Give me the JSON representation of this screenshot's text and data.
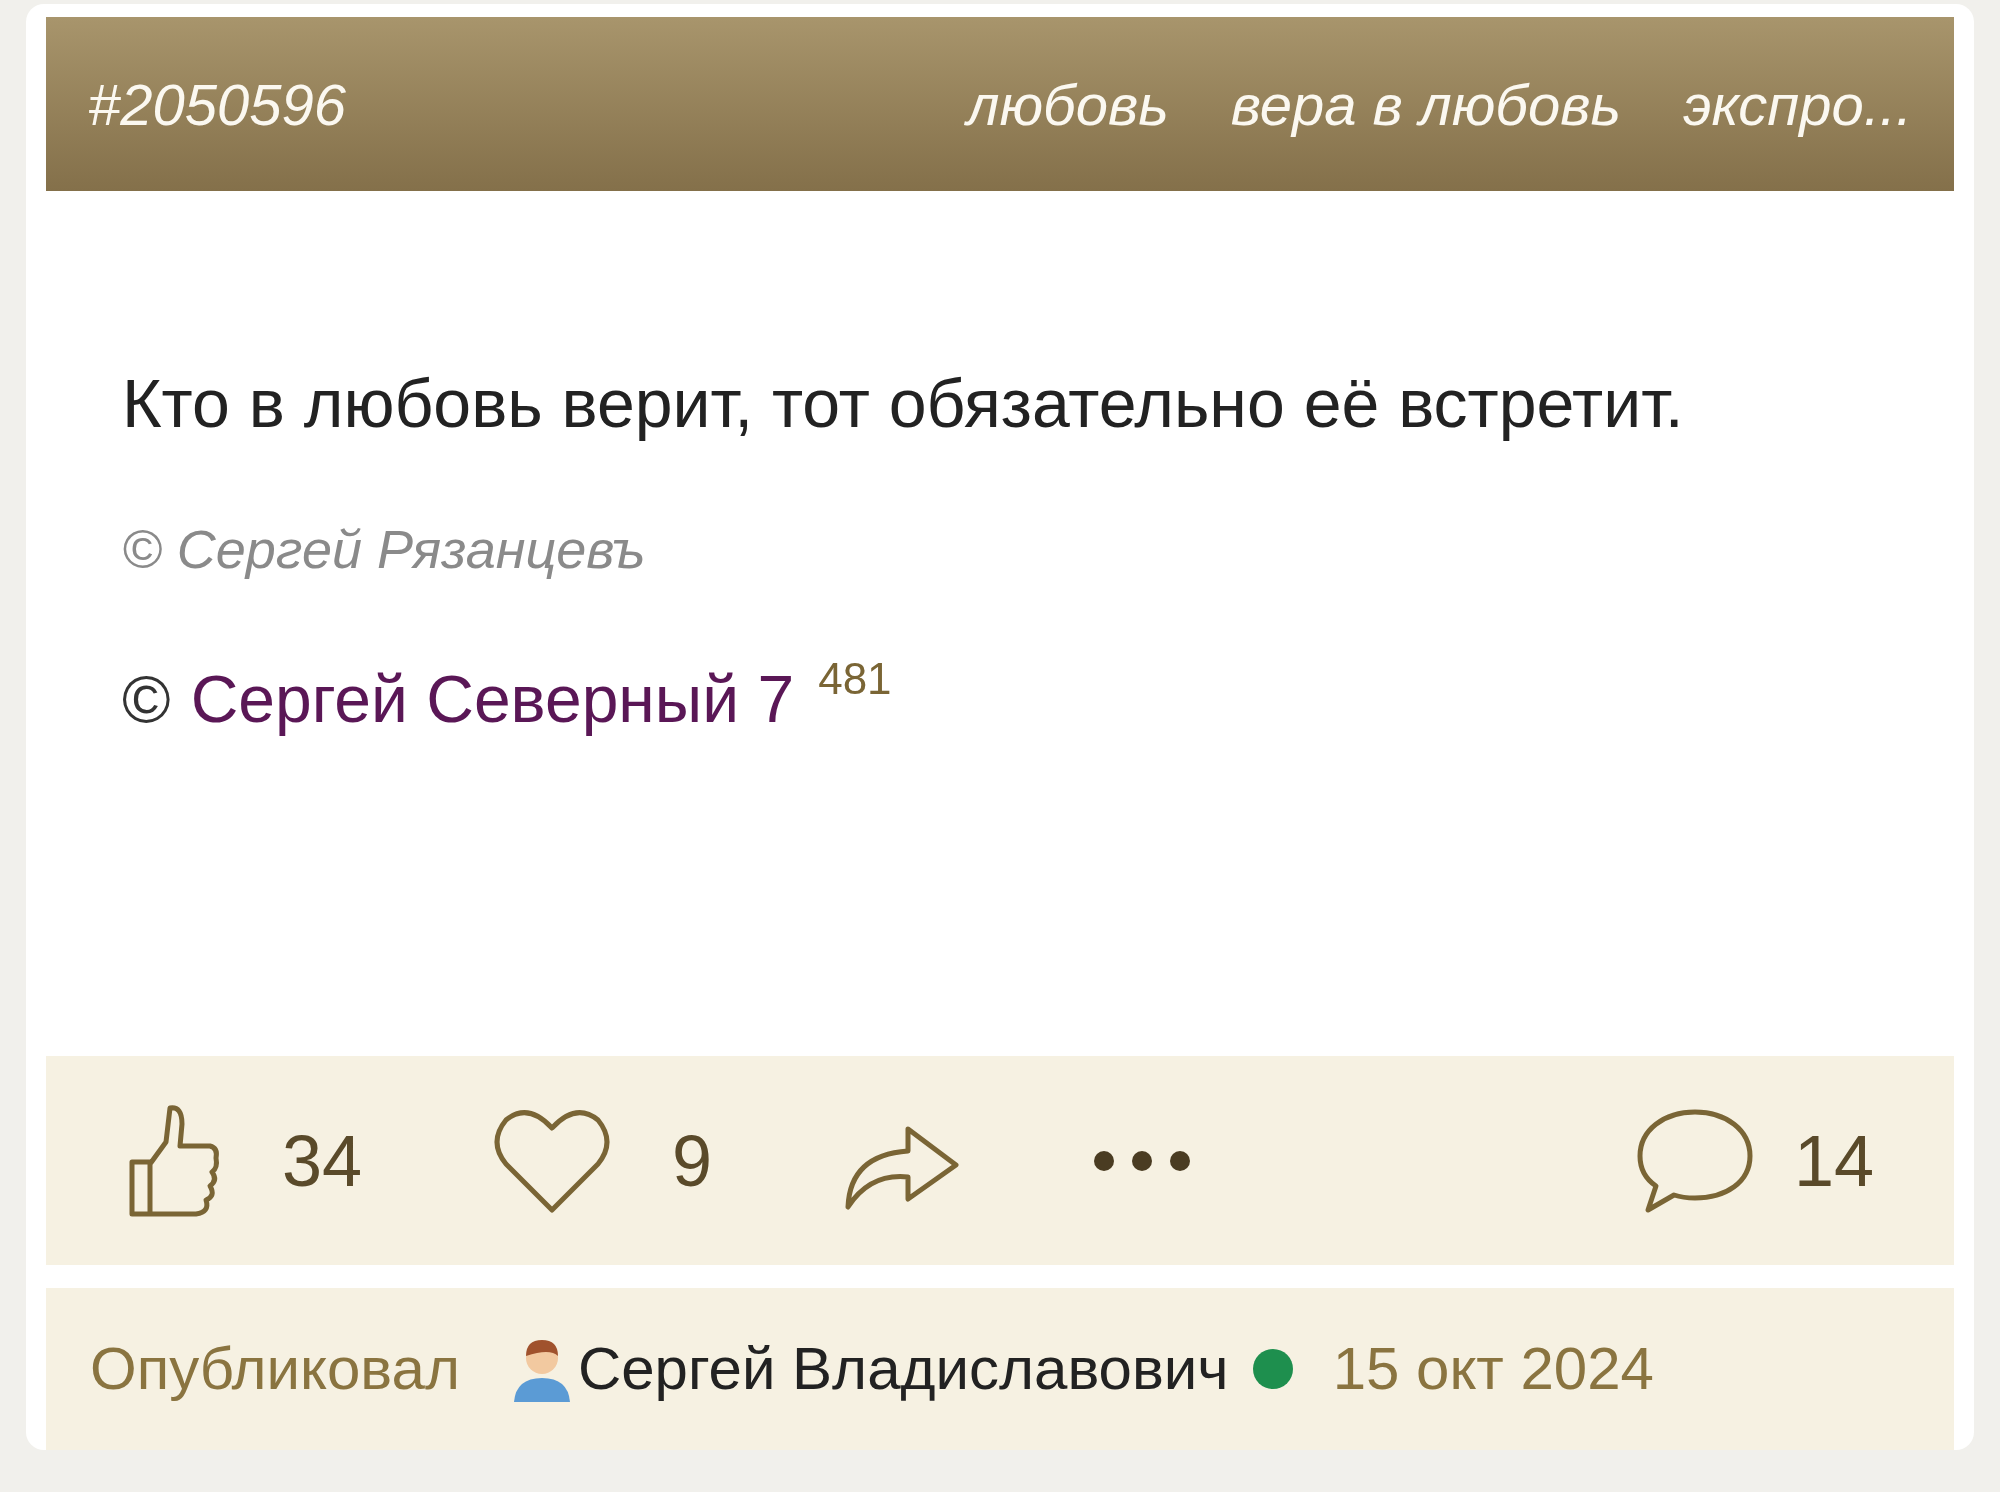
{
  "header": {
    "id": "#2050596",
    "tags": [
      "любовь",
      "вера в любовь",
      "экспро..."
    ]
  },
  "quote": {
    "text": "Кто в любовь верит, тот обязательно её встретит.",
    "source": "© Сергей Рязанцевъ"
  },
  "author": {
    "copyright": "©",
    "name": "Сергей Северный 7",
    "count": "481"
  },
  "actions": [
    {
      "kind": "like",
      "count": "34"
    },
    {
      "kind": "heart",
      "count": "9"
    },
    {
      "kind": "share"
    },
    {
      "kind": "more"
    }
  ],
  "comments": {
    "count": "14"
  },
  "footer": {
    "label": "Опубликовал",
    "user": "Сергей Владиславович",
    "online": true,
    "date": "15 окт 2024"
  }
}
